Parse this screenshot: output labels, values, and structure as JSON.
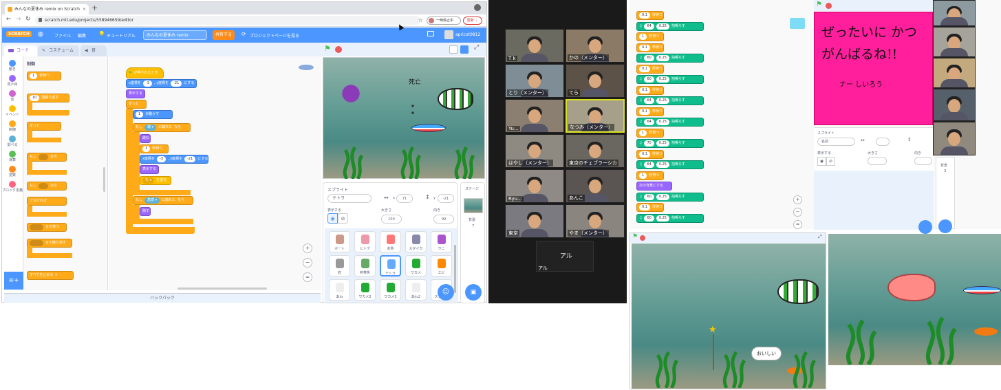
{
  "browser": {
    "tab_title": "みんなの夏休み remix on Scratch",
    "url": "scratch.mit.edu/projects/558946659/editor",
    "paused_label": "一時停止中",
    "update_label": "更新"
  },
  "menubar": {
    "logo": "SCRATCH",
    "file": "ファイル",
    "edit": "編集",
    "tutorial": "チュートリアル",
    "project_title": "みんなの夏休み remix",
    "share": "共有する",
    "project_page": "プロジェクトページを見る",
    "username": "apricot0812"
  },
  "tabs": {
    "code": "コード",
    "costume": "コスチューム",
    "sound": "音"
  },
  "categories": [
    {
      "label": "動き",
      "color": "#4c97ff"
    },
    {
      "label": "見た目",
      "color": "#9966ff"
    },
    {
      "label": "音",
      "color": "#cf63cf"
    },
    {
      "label": "イベント",
      "color": "#ffbf00"
    },
    {
      "label": "制御",
      "color": "#ffab19"
    },
    {
      "label": "調べる",
      "color": "#5cb1d6"
    },
    {
      "label": "演算",
      "color": "#59c059"
    },
    {
      "label": "変数",
      "color": "#ff8c1a"
    },
    {
      "label": "ブロック定義",
      "color": "#ff6680"
    }
  ],
  "palette": {
    "section": "制御",
    "wait": "秒待つ",
    "wait_val": "1",
    "repeat": "回繰り返す",
    "repeat_val": "10",
    "forever": "ずっと",
    "if": "もし",
    "then": "なら",
    "else": "でなければ",
    "wait_until": "まで待つ",
    "repeat_until": "まで繰り返す",
    "stop": "すべてを止める"
  },
  "script": {
    "hat": "が押されたとき",
    "goto_x": "x座標を",
    "goto_y": ", y座標を",
    "goto_end": "にする",
    "x1": "-3",
    "y1": "-21",
    "show": "表示する",
    "forever": "ずっと",
    "move_val": "1",
    "move": "歩動かす",
    "if": "もし",
    "touching": "に触れた",
    "then": "なら",
    "edge": "端",
    "bounce": "跳ね",
    "wait_val": "3",
    "wait": "秒待つ",
    "x2": "-3",
    "y2": "-21",
    "show2": "表示する",
    "send": "を送る",
    "msg": "む",
    "touch2": "恵底",
    "hide": "隠す"
  },
  "stage": {
    "death_label": "死亡"
  },
  "sprite_info": {
    "header": "スプライト",
    "name": "テトラ",
    "x": "71",
    "y": "-21",
    "show_label": "表示する",
    "size_label": "大きさ",
    "size": "100",
    "dir_label": "向き",
    "dir": "90"
  },
  "sprites": [
    {
      "name": "ボート",
      "color": "#c98"
    },
    {
      "name": "ヒトデ",
      "color": "#e9a"
    },
    {
      "name": "赤魚",
      "color": "#f77"
    },
    {
      "name": "大ダイカ",
      "color": "#88a"
    },
    {
      "name": "ウニ",
      "color": "#a5c"
    },
    {
      "name": "岩",
      "color": "#999"
    },
    {
      "name": "熱帯魚",
      "color": "#6a6"
    },
    {
      "name": "テトラ",
      "color": "#6af"
    },
    {
      "name": "ワカメ",
      "color": "#2a3"
    },
    {
      "name": "エビ",
      "color": "#f80"
    },
    {
      "name": "あわ",
      "color": "#eee"
    },
    {
      "name": "ワカメ2",
      "color": "#2a3"
    },
    {
      "name": "ワカメ3",
      "color": "#2a3"
    },
    {
      "name": "あわ2",
      "color": "#eee"
    },
    {
      "name": "スプライ",
      "color": "#fff"
    }
  ],
  "stage_panel": {
    "header": "ステージ",
    "bg_label": "背景",
    "bg_count": "7"
  },
  "backpack": "バックパック",
  "zoom": {
    "participants": [
      {
        "name": "T k"
      },
      {
        "name": "かの（メンター）"
      },
      {
        "name": "とり（メンター）"
      },
      {
        "name": "てら"
      },
      {
        "name": "Yu..."
      },
      {
        "name": "なつみ（メンター）"
      },
      {
        "name": "はやし（メンター）"
      },
      {
        "name": "東京のチェブラーシカ"
      },
      {
        "name": "Ryu..."
      },
      {
        "name": "あんこ"
      },
      {
        "name": "東京"
      },
      {
        "name": "やま（メンター）"
      }
    ],
    "speaker_name": "アル",
    "speaker_label": "アル"
  },
  "right_code": {
    "rows": [
      {
        "type": "wait",
        "val": "0.1",
        "label": "秒待つ"
      },
      {
        "type": "note",
        "n": "64",
        "b": "0.25",
        "label": "拍鳴らす"
      },
      {
        "type": "wait",
        "val": "1",
        "label": "秒待つ"
      },
      {
        "type": "wait",
        "val": "0.1",
        "label": "秒待つ"
      },
      {
        "type": "note",
        "n": "60",
        "b": "0.25",
        "label": "拍鳴らす"
      },
      {
        "type": "wait",
        "val": "0.1",
        "label": "秒待つ"
      },
      {
        "type": "note",
        "n": "60",
        "b": "0.25",
        "label": "拍鳴らす"
      },
      {
        "type": "wait",
        "val": "0.1",
        "label": "秒待つ"
      },
      {
        "type": "note",
        "n": "64",
        "b": "0.25",
        "label": "拍鳴らす"
      },
      {
        "type": "wait",
        "val": "0.1",
        "label": "秒待つ"
      },
      {
        "type": "note",
        "n": "64",
        "b": "0.25",
        "label": "拍鳴らす"
      },
      {
        "type": "wait",
        "val": "1",
        "label": "秒待つ"
      },
      {
        "type": "note",
        "n": "70",
        "b": "0.25",
        "label": "拍鳴らす"
      },
      {
        "type": "wait",
        "val": "0.1",
        "label": "秒待つ"
      },
      {
        "type": "note",
        "n": "64",
        "b": "0.25",
        "label": "拍鳴らす"
      },
      {
        "type": "wait",
        "val": "1",
        "label": "秒待つ"
      },
      {
        "type": "looks",
        "val": "",
        "label": "次の背景にする"
      },
      {
        "type": "note",
        "n": "60",
        "b": "0.25",
        "label": "拍鳴らす"
      },
      {
        "type": "wait",
        "val": "0.1",
        "label": "秒待つ"
      },
      {
        "type": "note",
        "n": "60",
        "b": "0.25",
        "label": "拍鳴らす"
      }
    ]
  },
  "pink_note": {
    "line1": "ぜったいに かつ",
    "line2": "がんばるね!!",
    "sign": "ナー しいろう"
  },
  "right_sprite": {
    "header": "スプライト",
    "name": "名前",
    "show": "表示する",
    "size": "大きさ",
    "dir": "向き",
    "stage": "背景",
    "stage_count": "3"
  },
  "bottom_stage": {
    "speech": "おいしい"
  }
}
